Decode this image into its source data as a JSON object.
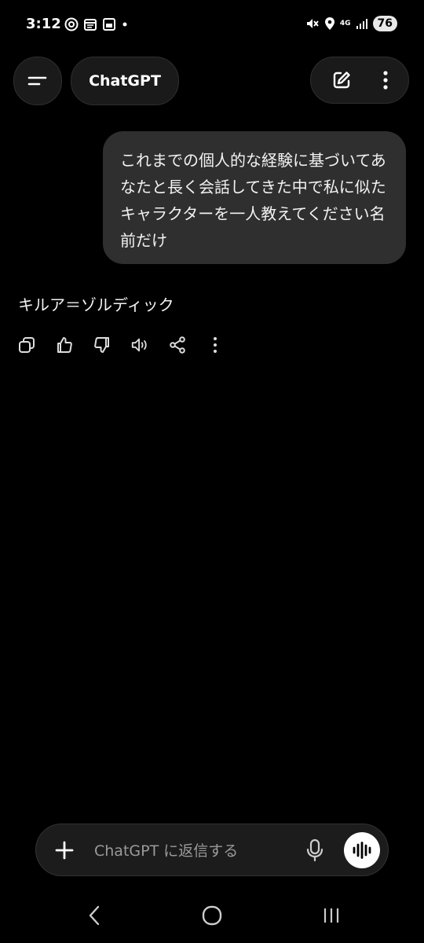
{
  "status_bar": {
    "time": "3:12",
    "network": "4G",
    "battery": "76"
  },
  "header": {
    "title": "ChatGPT"
  },
  "conversation": {
    "user_message": "これまでの個人的な経験に基づいてあなたと長く会話してきた中で私に似たキャラクターを一人教えてください名前だけ",
    "assistant_message": "キルア＝ゾルディック"
  },
  "composer": {
    "placeholder": "ChatGPT に返信する"
  },
  "icons": {
    "menu": "menu-icon",
    "edit": "edit-icon",
    "more": "more-vertical-icon",
    "copy": "copy-icon",
    "thumbs_up": "thumbs-up-icon",
    "thumbs_down": "thumbs-down-icon",
    "speaker": "speaker-icon",
    "share": "share-icon",
    "plus": "plus-icon",
    "mic": "mic-icon",
    "voice": "voice-waveform-icon"
  },
  "colors": {
    "background": "#000000",
    "bubble": "#2f2f2f",
    "surface": "#1a1a1a",
    "text": "#f2f2f2",
    "placeholder": "#9a9a9a"
  }
}
